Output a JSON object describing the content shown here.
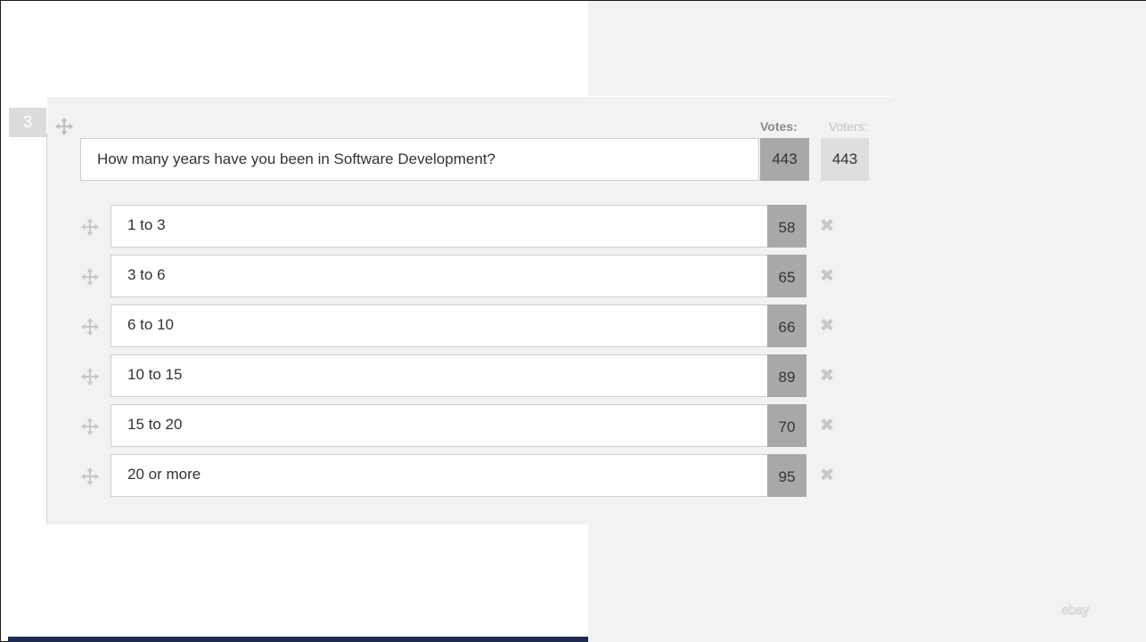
{
  "question": {
    "number": "3",
    "text": "How many years have you been in Software Development?",
    "votes_label": "Votes:",
    "voters_label": "Voters:",
    "votes": "443",
    "voters": "443"
  },
  "options": [
    {
      "label": "1 to 3",
      "votes": "58"
    },
    {
      "label": "3 to 6",
      "votes": "65"
    },
    {
      "label": "6 to 10",
      "votes": "66"
    },
    {
      "label": "10 to 15",
      "votes": "89"
    },
    {
      "label": "15 to 20",
      "votes": "70"
    },
    {
      "label": "20 or more",
      "votes": "95"
    }
  ],
  "icons": {
    "drag": "move-icon",
    "remove": "close-icon"
  },
  "remove_glyph": "✖",
  "brand": {
    "logo_text": "ebay"
  },
  "colors": {
    "votes_bg": "#a8a8a8",
    "voters_bg": "#dedede",
    "panel_bg": "#f2f2f2",
    "bottom_bar": "#1f2a4e"
  }
}
